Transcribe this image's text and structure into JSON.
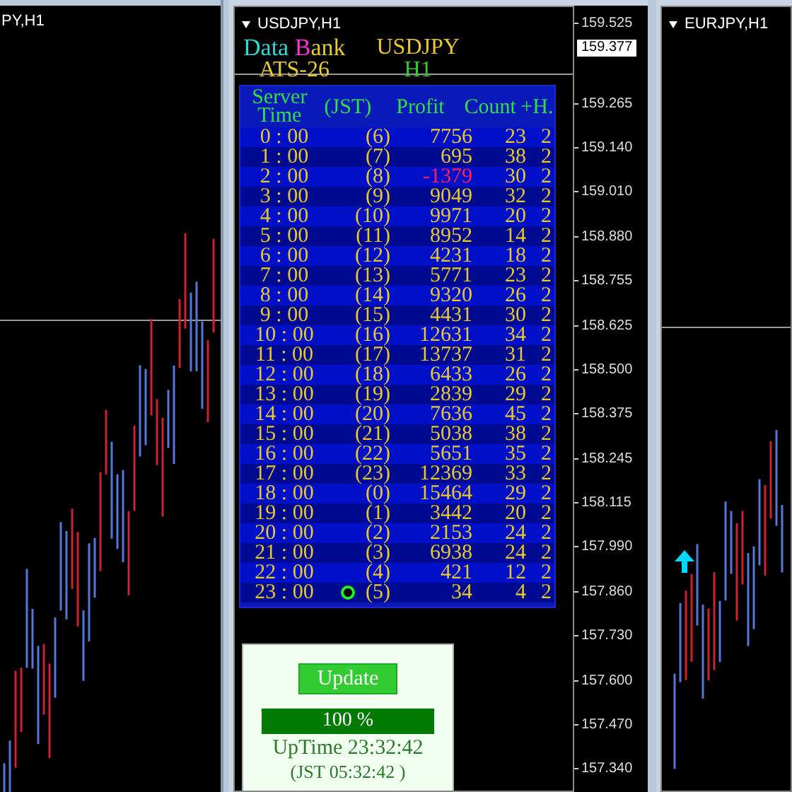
{
  "left_chart": {
    "title": "PY,H1"
  },
  "main_chart": {
    "title": "USDJPY,H1",
    "current_price": "159.377",
    "price_axis": [
      "159.525",
      "159.265",
      "159.140",
      "159.010",
      "158.880",
      "158.755",
      "158.625",
      "158.500",
      "158.375",
      "158.245",
      "158.115",
      "157.990",
      "157.860",
      "157.730",
      "157.600",
      "157.470",
      "157.340"
    ],
    "panel": {
      "brand": [
        {
          "text": "Data ",
          "color": "#33d6d6"
        },
        {
          "text": "B",
          "color": "#ff33cc"
        },
        {
          "text": "ank",
          "color": "#e8c830"
        }
      ],
      "system": "ATS-26",
      "symbol": "USDJPY",
      "timeframe": "H1",
      "columns": [
        "Server Time",
        "(JST)",
        "Profit",
        "Count",
        "+H."
      ],
      "rows": [
        {
          "time": "0 : 00",
          "jst": "(6)",
          "profit": "7756",
          "count": "23",
          "h": "2",
          "loss": false,
          "current": false
        },
        {
          "time": "1 : 00",
          "jst": "(7)",
          "profit": "695",
          "count": "38",
          "h": "2",
          "loss": false,
          "current": false
        },
        {
          "time": "2 : 00",
          "jst": "(8)",
          "profit": "-1379",
          "count": "30",
          "h": "2",
          "loss": true,
          "current": false
        },
        {
          "time": "3 : 00",
          "jst": "(9)",
          "profit": "9049",
          "count": "32",
          "h": "2",
          "loss": false,
          "current": false
        },
        {
          "time": "4 : 00",
          "jst": "(10)",
          "profit": "9971",
          "count": "20",
          "h": "2",
          "loss": false,
          "current": false
        },
        {
          "time": "5 : 00",
          "jst": "(11)",
          "profit": "8952",
          "count": "14",
          "h": "2",
          "loss": false,
          "current": false
        },
        {
          "time": "6 : 00",
          "jst": "(12)",
          "profit": "4231",
          "count": "18",
          "h": "2",
          "loss": false,
          "current": false
        },
        {
          "time": "7 : 00",
          "jst": "(13)",
          "profit": "5771",
          "count": "23",
          "h": "2",
          "loss": false,
          "current": false
        },
        {
          "time": "8 : 00",
          "jst": "(14)",
          "profit": "9320",
          "count": "26",
          "h": "2",
          "loss": false,
          "current": false
        },
        {
          "time": "9 : 00",
          "jst": "(15)",
          "profit": "4431",
          "count": "30",
          "h": "2",
          "loss": false,
          "current": false
        },
        {
          "time": "10 : 00",
          "jst": "(16)",
          "profit": "12631",
          "count": "34",
          "h": "2",
          "loss": false,
          "current": false
        },
        {
          "time": "11 : 00",
          "jst": "(17)",
          "profit": "13737",
          "count": "31",
          "h": "2",
          "loss": false,
          "current": false
        },
        {
          "time": "12 : 00",
          "jst": "(18)",
          "profit": "6433",
          "count": "26",
          "h": "2",
          "loss": false,
          "current": false
        },
        {
          "time": "13 : 00",
          "jst": "(19)",
          "profit": "2839",
          "count": "29",
          "h": "2",
          "loss": false,
          "current": false
        },
        {
          "time": "14 : 00",
          "jst": "(20)",
          "profit": "7636",
          "count": "45",
          "h": "2",
          "loss": false,
          "current": false
        },
        {
          "time": "15 : 00",
          "jst": "(21)",
          "profit": "5038",
          "count": "38",
          "h": "2",
          "loss": false,
          "current": false
        },
        {
          "time": "16 : 00",
          "jst": "(22)",
          "profit": "5651",
          "count": "35",
          "h": "2",
          "loss": false,
          "current": false
        },
        {
          "time": "17 : 00",
          "jst": "(23)",
          "profit": "12369",
          "count": "33",
          "h": "2",
          "loss": false,
          "current": false
        },
        {
          "time": "18 : 00",
          "jst": "(0)",
          "profit": "15464",
          "count": "29",
          "h": "2",
          "loss": false,
          "current": false
        },
        {
          "time": "19 : 00",
          "jst": "(1)",
          "profit": "3442",
          "count": "20",
          "h": "2",
          "loss": false,
          "current": false
        },
        {
          "time": "20 : 00",
          "jst": "(2)",
          "profit": "2153",
          "count": "24",
          "h": "2",
          "loss": false,
          "current": false
        },
        {
          "time": "21 : 00",
          "jst": "(3)",
          "profit": "6938",
          "count": "24",
          "h": "2",
          "loss": false,
          "current": false
        },
        {
          "time": "22 : 00",
          "jst": "(4)",
          "profit": "421",
          "count": "12",
          "h": "2",
          "loss": false,
          "current": false
        },
        {
          "time": "23 : 00",
          "jst": "(5)",
          "profit": "34",
          "count": "4",
          "h": "2",
          "loss": false,
          "current": true
        }
      ]
    },
    "control_box": {
      "button": "Update",
      "progress": {
        "level": 1,
        "label": "100 %"
      },
      "uptime": "UpTime 23:32:42",
      "jst_time": "(JST 05:32:42 )"
    }
  },
  "right_chart": {
    "title": "EURJPY,H1"
  }
}
